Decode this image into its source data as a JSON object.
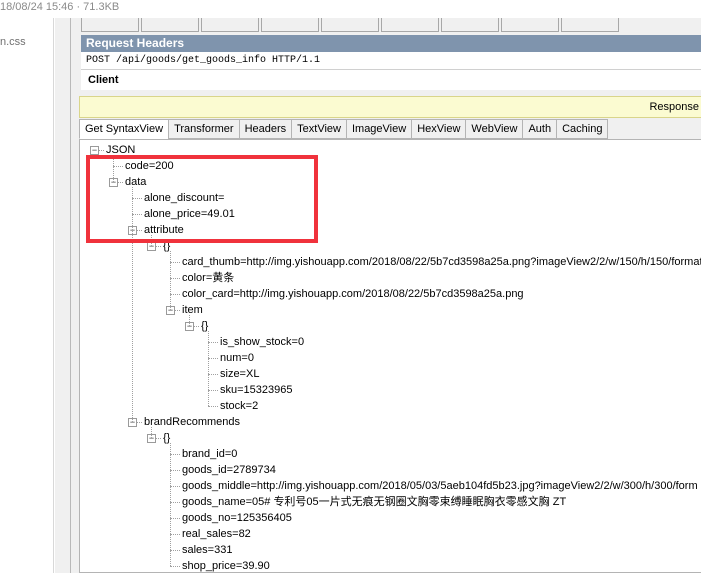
{
  "top": {
    "info": "18/08/24 15:46 · 71.3KB"
  },
  "left": {
    "file": "n.css"
  },
  "request": {
    "header": "Request Headers",
    "line": "POST /api/goods/get_goods_info HTTP/1.1",
    "client": "Client"
  },
  "response": {
    "label": "Response"
  },
  "tabs": [
    "Get SyntaxView",
    "Transformer",
    "Headers",
    "TextView",
    "ImageView",
    "HexView",
    "WebView",
    "Auth",
    "Caching"
  ],
  "tree": [
    {
      "text": "JSON",
      "depth": 0,
      "expander": "-"
    },
    {
      "text": "code=200",
      "depth": 1,
      "expander": null
    },
    {
      "text": "data",
      "depth": 1,
      "expander": "-"
    },
    {
      "text": "alone_discount=",
      "depth": 2,
      "expander": null
    },
    {
      "text": "alone_price=49.01",
      "depth": 2,
      "expander": null
    },
    {
      "text": "attribute",
      "depth": 2,
      "expander": "-"
    },
    {
      "text": "{}",
      "depth": 3,
      "expander": "-"
    },
    {
      "text": "card_thumb=http://img.yishouapp.com/2018/08/22/5b7cd3598a25a.png?imageView2/2/w/150/h/150/format",
      "depth": 4,
      "expander": null
    },
    {
      "text": "color=黄条",
      "depth": 4,
      "expander": null
    },
    {
      "text": "color_card=http://img.yishouapp.com/2018/08/22/5b7cd3598a25a.png",
      "depth": 4,
      "expander": null
    },
    {
      "text": "item",
      "depth": 4,
      "expander": "-"
    },
    {
      "text": "{}",
      "depth": 5,
      "expander": "-"
    },
    {
      "text": "is_show_stock=0",
      "depth": 6,
      "expander": null
    },
    {
      "text": "num=0",
      "depth": 6,
      "expander": null
    },
    {
      "text": "size=XL",
      "depth": 6,
      "expander": null
    },
    {
      "text": "sku=15323965",
      "depth": 6,
      "expander": null
    },
    {
      "text": "stock=2",
      "depth": 6,
      "expander": null
    },
    {
      "text": "brandRecommends",
      "depth": 2,
      "expander": "-"
    },
    {
      "text": "{}",
      "depth": 3,
      "expander": "-"
    },
    {
      "text": "brand_id=0",
      "depth": 4,
      "expander": null
    },
    {
      "text": "goods_id=2789734",
      "depth": 4,
      "expander": null
    },
    {
      "text": "goods_middle=http://img.yishouapp.com/2018/05/03/5aeb104fd5b23.jpg?imageView2/2/w/300/h/300/form",
      "depth": 4,
      "expander": null
    },
    {
      "text": "goods_name=05# 专利号05一片式无痕无钢圈文胸零束缚睡眠胸衣零感文胸 ZT",
      "depth": 4,
      "expander": null
    },
    {
      "text": "goods_no=125356405",
      "depth": 4,
      "expander": null
    },
    {
      "text": "real_sales=82",
      "depth": 4,
      "expander": null
    },
    {
      "text": "sales=331",
      "depth": 4,
      "expander": null
    },
    {
      "text": "shop_price=39.90",
      "depth": 4,
      "expander": null
    }
  ],
  "colors": {
    "header_bg": "#7f94ad",
    "response_bar": "#fbfbd1",
    "highlight_box": "#f0323c"
  }
}
